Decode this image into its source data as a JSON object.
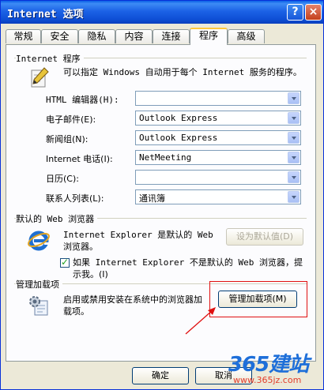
{
  "window": {
    "title": "Internet 选项"
  },
  "titlebar_buttons": {
    "help": "?",
    "close": "×"
  },
  "tabs": [
    "常规",
    "安全",
    "隐私",
    "内容",
    "连接",
    "程序",
    "高级"
  ],
  "active_tab": "程序",
  "programs_group": {
    "title": "Internet 程序",
    "description": "可以指定 Windows 自动用于每个 Internet 服务的程序。",
    "rows": [
      {
        "label": "HTML 编辑器(H):",
        "value": ""
      },
      {
        "label": "电子邮件(E):",
        "value": "Outlook Express"
      },
      {
        "label": "新闻组(N):",
        "value": "Outlook Express"
      },
      {
        "label": "Internet 电话(I):",
        "value": "NetMeeting"
      },
      {
        "label": "日历(C):",
        "value": ""
      },
      {
        "label": "联系人列表(L):",
        "value": "通讯簿"
      }
    ]
  },
  "default_browser_group": {
    "title": "默认的 Web 浏览器",
    "status_line1": "Internet Explorer 是默认的 Web",
    "status_line2": "浏览器。",
    "set_default_button": "设为默认值(D)",
    "check_label_line1": "如果 Internet Explorer 不是默认的 Web 浏览器，提",
    "check_label_line2": "示我。(I)",
    "check_checked": true
  },
  "addons_group": {
    "title": "管理加载项",
    "description_line1": "启用或禁用安装在系统中的浏览器加",
    "description_line2": "载项。",
    "manage_button": "管理加载项(M)"
  },
  "footer": {
    "ok_button": "确定",
    "cancel_button": "取消"
  },
  "watermark": {
    "brand": "365建站",
    "url": "www.365jz.com"
  },
  "colors": {
    "titlebar": "#0a5fe6",
    "highlight_box": "#e01010",
    "active_tab_accent": "#ffc83c"
  }
}
